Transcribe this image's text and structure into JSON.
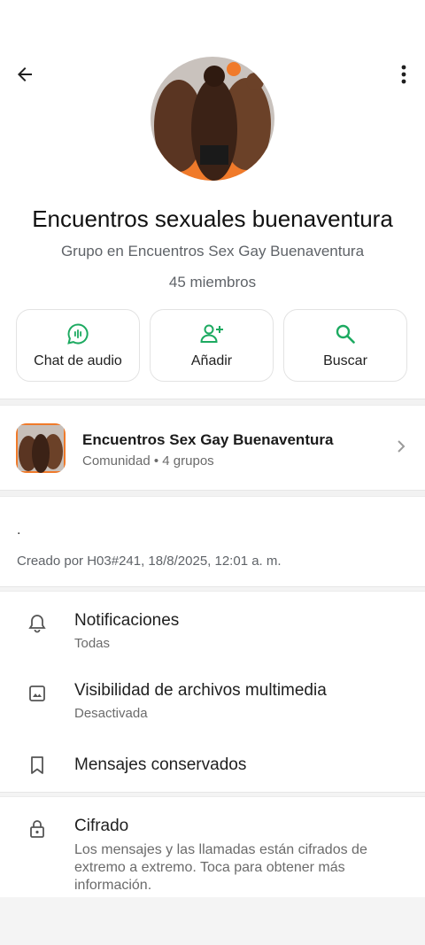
{
  "header": {
    "back_icon": "arrow-left-icon",
    "menu_icon": "more-vertical-icon"
  },
  "group": {
    "name": "Encuentros sexuales buenaventura",
    "subtitle": "Grupo en Encuentros Sex Gay Buenaventura",
    "members": "45 miembros"
  },
  "actions": [
    {
      "label": "Chat de audio",
      "icon": "audio-chat-icon"
    },
    {
      "label": "Añadir",
      "icon": "add-person-icon"
    },
    {
      "label": "Buscar",
      "icon": "search-icon"
    }
  ],
  "community": {
    "name": "Encuentros Sex Gay Buenaventura",
    "meta": "Comunidad • 4 grupos"
  },
  "description": ".",
  "created": "Creado por H03#241, 18/8/2025, 12:01 a. m.",
  "settings": {
    "notifications": {
      "title": "Notificaciones",
      "sub": "Todas"
    },
    "media": {
      "title": "Visibilidad de archivos multimedia",
      "sub": "Desactivada"
    },
    "kept": {
      "title": "Mensajes conservados"
    },
    "encryption": {
      "title": "Cifrado",
      "line1": "Los mensajes y las llamadas están cifrados de",
      "line2": "extremo a extremo. Toca para obtener más",
      "line3": "información."
    }
  },
  "colors": {
    "accent": "#1daa61",
    "avatar_ring": "#f07a2a"
  }
}
